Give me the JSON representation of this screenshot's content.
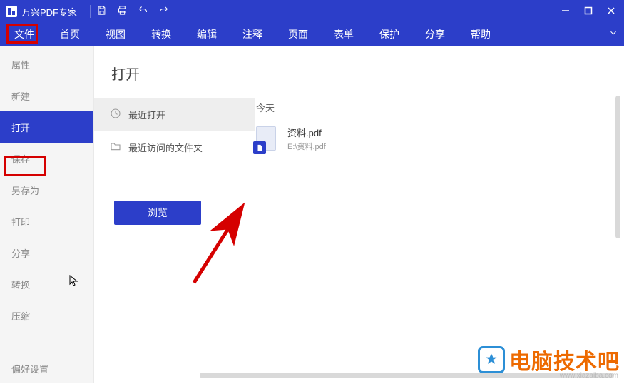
{
  "titlebar": {
    "app_name": "万兴PDF专家"
  },
  "menubar": {
    "items": [
      "文件",
      "首页",
      "视图",
      "转换",
      "编辑",
      "注释",
      "页面",
      "表单",
      "保护",
      "分享",
      "帮助"
    ]
  },
  "sidebar": {
    "items": [
      {
        "label": "属性"
      },
      {
        "label": "新建"
      },
      {
        "label": "打开",
        "active": true
      },
      {
        "label": "保存"
      },
      {
        "label": "另存为"
      },
      {
        "label": "打印"
      },
      {
        "label": "分享"
      },
      {
        "label": "转换"
      },
      {
        "label": "压缩"
      }
    ],
    "pref_label": "偏好设置"
  },
  "open_view": {
    "heading": "打开",
    "options": [
      {
        "label": "最近打开",
        "selected": true,
        "icon": "clock"
      },
      {
        "label": "最近访问的文件夹",
        "selected": false,
        "icon": "folder"
      }
    ],
    "browse_label": "浏览",
    "section_label": "今天",
    "files": [
      {
        "name": "资料.pdf",
        "path": "E:\\资料.pdf"
      }
    ]
  },
  "watermark": {
    "text": "电脑技术吧",
    "sub": "www.xiazaiba.com"
  }
}
